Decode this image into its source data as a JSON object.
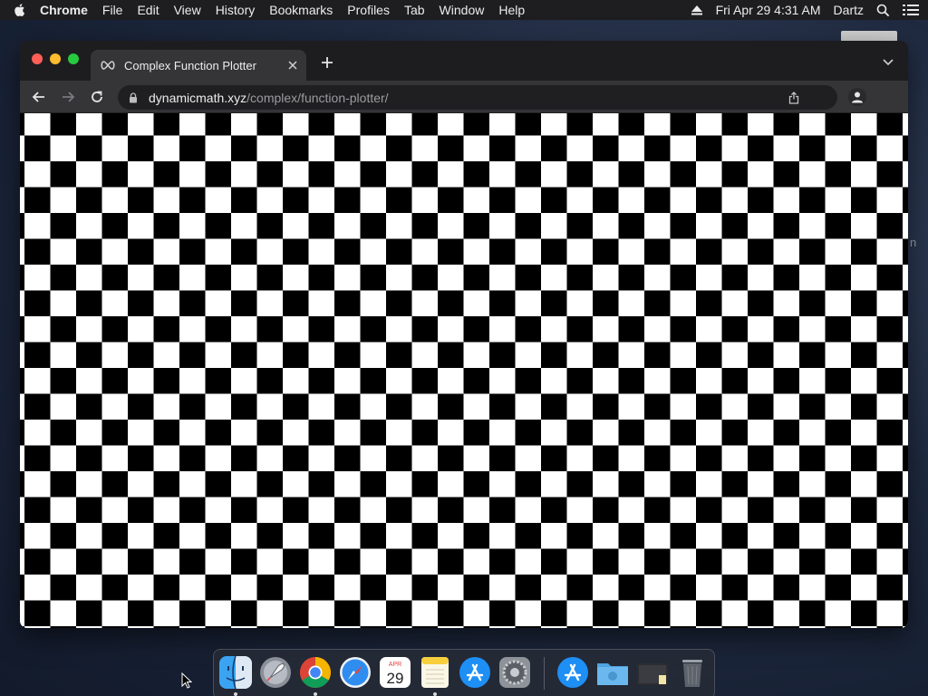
{
  "menubar": {
    "app": "Chrome",
    "items": [
      "File",
      "Edit",
      "View",
      "History",
      "Bookmarks",
      "Profiles",
      "Tab",
      "Window",
      "Help"
    ],
    "datetime": "Fri Apr 29  4:31 AM",
    "user": "Dartz",
    "icons": [
      "apple-icon",
      "eject-icon",
      "search-icon",
      "control-center-icon"
    ]
  },
  "browser": {
    "tab_title": "Complex Function Plotter",
    "tab_favicon": "infinity-icon",
    "url_domain": "dynamicmath.xyz",
    "url_path": "/complex/function-plotter/"
  },
  "page": {
    "content": "checkerboard-plot"
  },
  "desktop": {
    "partial_text": "n"
  },
  "dock": {
    "apps": [
      "Finder",
      "Launchpad",
      "Google Chrome",
      "Safari",
      "Calendar",
      "Notes",
      "App Store",
      "System Preferences"
    ],
    "stack": [
      "Applications",
      "Downloads",
      "Documents",
      "Trash"
    ],
    "calendar": {
      "month": "APR",
      "day": "29"
    }
  },
  "colors": {
    "menubar": "#1e1e20",
    "tabstrip": "#1d1d1f",
    "toolbar": "#353538",
    "omnibox": "#1f1f21",
    "close": "#ff5f57",
    "minimize": "#febc2e",
    "maximize": "#28c840"
  }
}
